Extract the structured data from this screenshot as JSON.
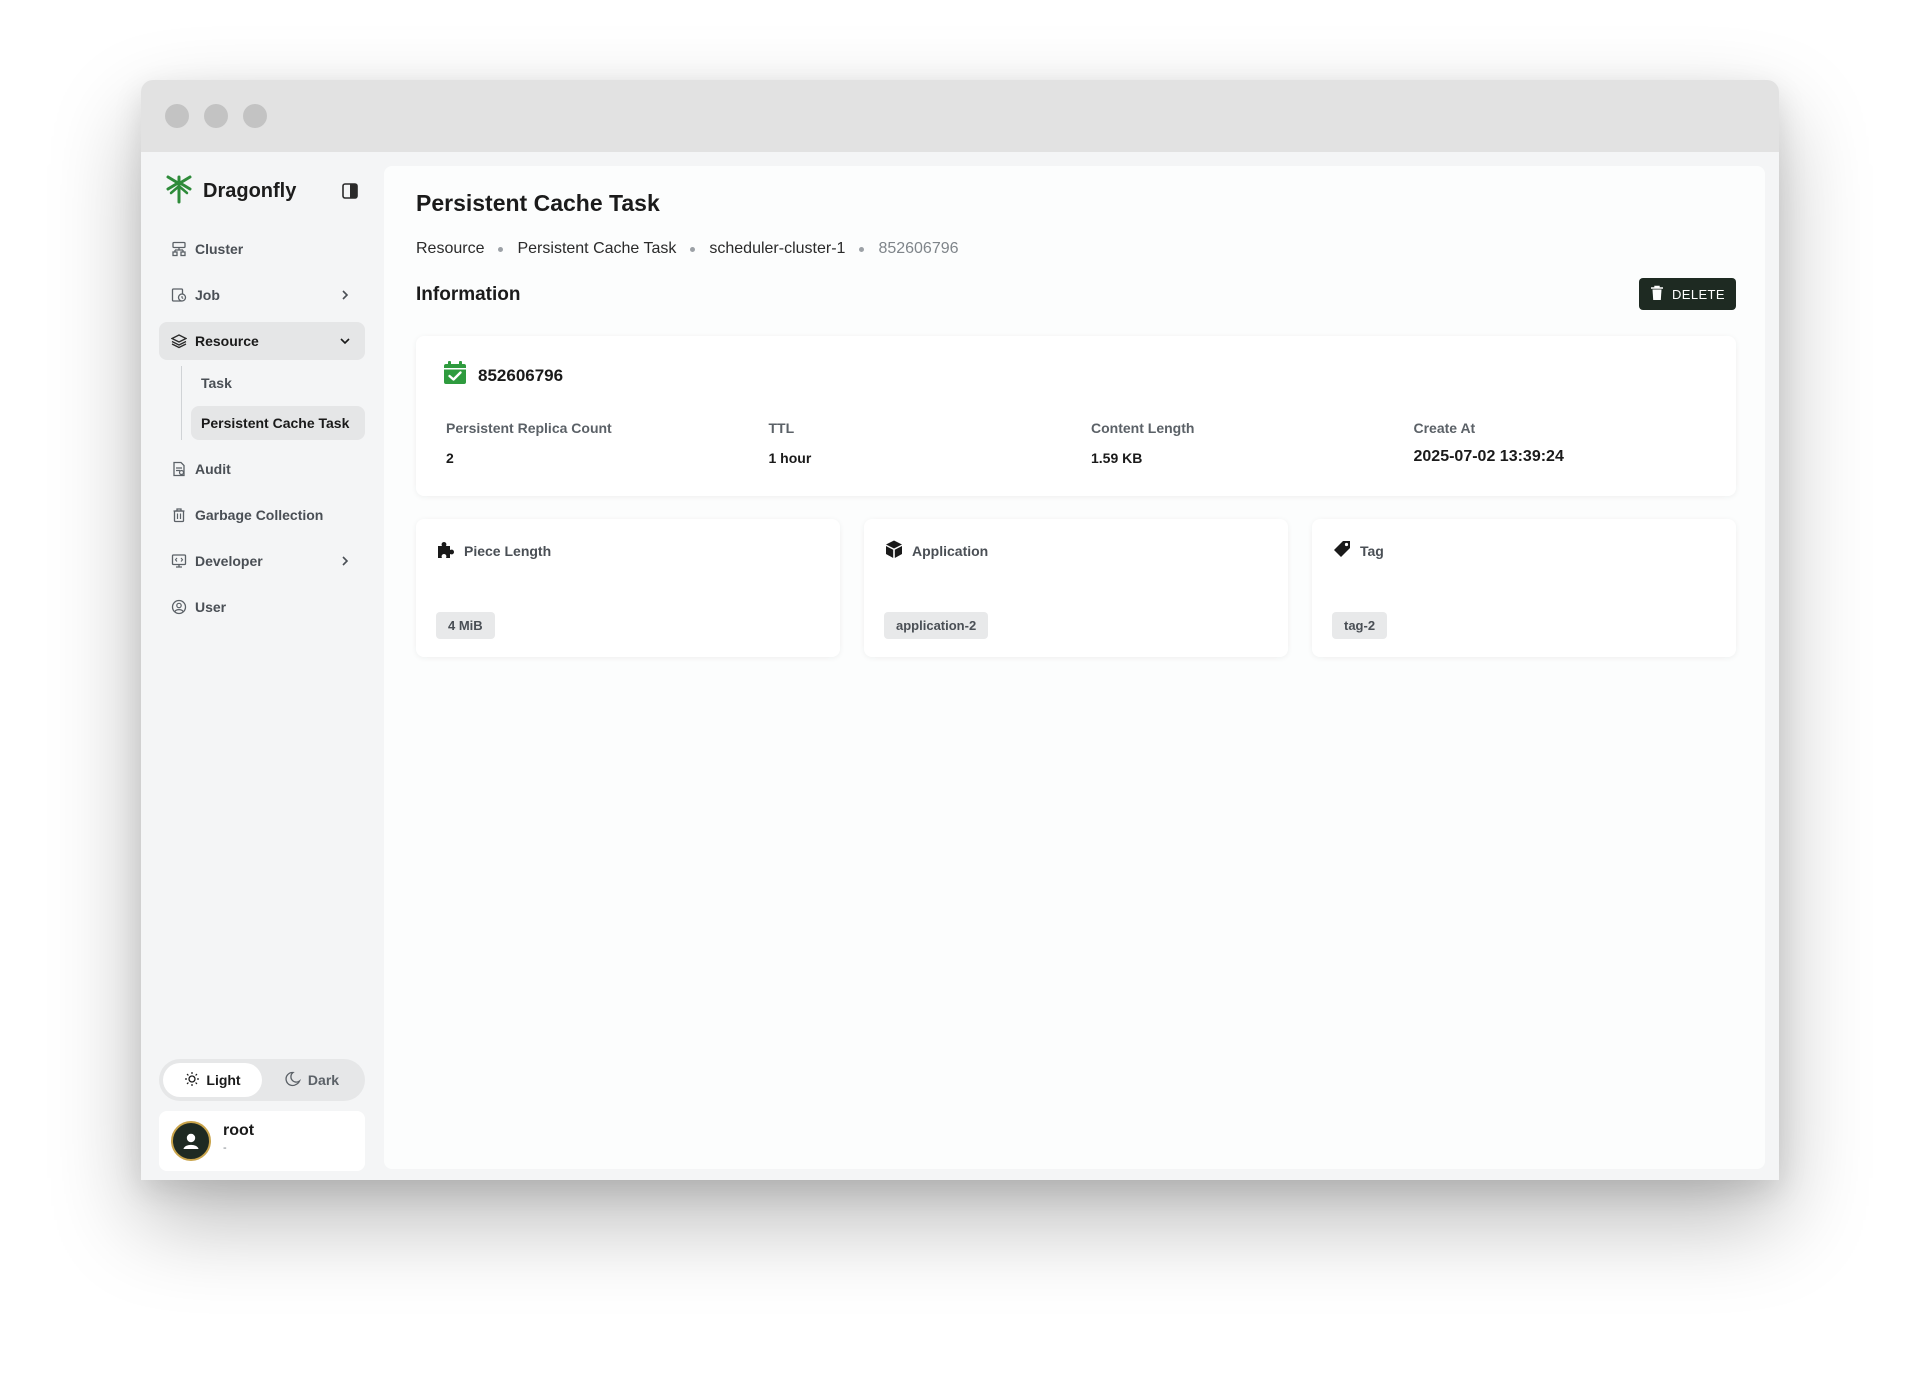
{
  "app": {
    "name": "Dragonfly"
  },
  "sidebar": {
    "items": [
      {
        "label": "Cluster"
      },
      {
        "label": "Job"
      },
      {
        "label": "Resource"
      },
      {
        "label": "Audit"
      },
      {
        "label": "Garbage Collection"
      },
      {
        "label": "Developer"
      },
      {
        "label": "User"
      }
    ],
    "resource_sub": [
      {
        "label": "Task"
      },
      {
        "label": "Persistent Cache Task"
      }
    ]
  },
  "theme": {
    "light": "Light",
    "dark": "Dark"
  },
  "user": {
    "name": "root",
    "sub": "-"
  },
  "page": {
    "title": "Persistent Cache Task",
    "breadcrumb": [
      "Resource",
      "Persistent Cache Task",
      "scheduler-cluster-1",
      "852606796"
    ],
    "section_title": "Information",
    "delete_label": "DELETE"
  },
  "info": {
    "id": "852606796",
    "fields": [
      {
        "label": "Persistent Replica Count",
        "value": "2"
      },
      {
        "label": "TTL",
        "value": "1 hour"
      },
      {
        "label": "Content Length",
        "value": "1.59 KB"
      },
      {
        "label": "Create At",
        "value": "2025-07-02 13:39:24"
      }
    ]
  },
  "cards": [
    {
      "title": "Piece Length",
      "value": "4 MiB",
      "icon": "puzzle-icon"
    },
    {
      "title": "Application",
      "value": "application-2",
      "icon": "cube-icon"
    },
    {
      "title": "Tag",
      "value": "tag-2",
      "icon": "tag-icon"
    }
  ],
  "colors": {
    "accent": "#1e2a22",
    "brand_green": "#2e8b3a",
    "status_green": "#2e9b3e"
  }
}
